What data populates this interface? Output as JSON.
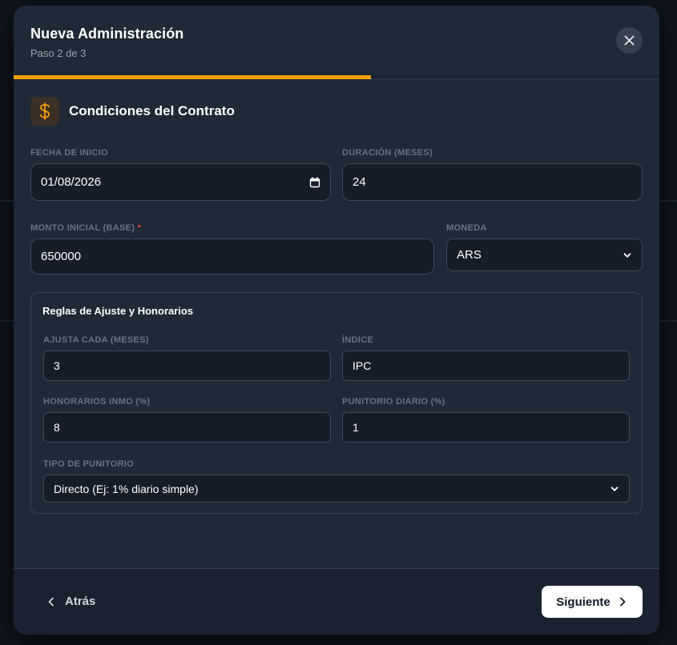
{
  "modal": {
    "title": "Nueva Administración",
    "step": "Paso 2 de 3",
    "progress": 0.667
  },
  "section": {
    "title": "Condiciones del Contrato",
    "icon": "dollar-icon"
  },
  "form": {
    "start_date": {
      "label": "FECHA DE INICIO",
      "value": "01/08/2026"
    },
    "duration": {
      "label": "DURACIÓN (MESES)",
      "value": "24"
    },
    "amount": {
      "label": "MONTO INICIAL (BASE)",
      "required_mark": "*",
      "value": "650000"
    },
    "currency": {
      "label": "MONEDA",
      "value": "ARS"
    }
  },
  "rules": {
    "title": "Reglas de Ajuste y Honorarios",
    "adjust_every": {
      "label": "AJUSTA CADA (MESES)",
      "value": "3"
    },
    "index": {
      "label": "ÍNDICE",
      "value": "IPC"
    },
    "fees": {
      "label": "HONORARIOS INMO (%)",
      "value": "8"
    },
    "daily_penalty": {
      "label": "PUNITORIO DIARIO (%)",
      "value": "1"
    },
    "penalty_type": {
      "label": "TIPO DE PUNITORIO",
      "value": "Directo (Ej: 1% diario simple)"
    }
  },
  "footer": {
    "back_label": "Atrás",
    "next_label": "Siguiente"
  },
  "colors": {
    "accent": "#f59e0b",
    "modal_bg": "#1f2937",
    "required": "#ef4444"
  }
}
